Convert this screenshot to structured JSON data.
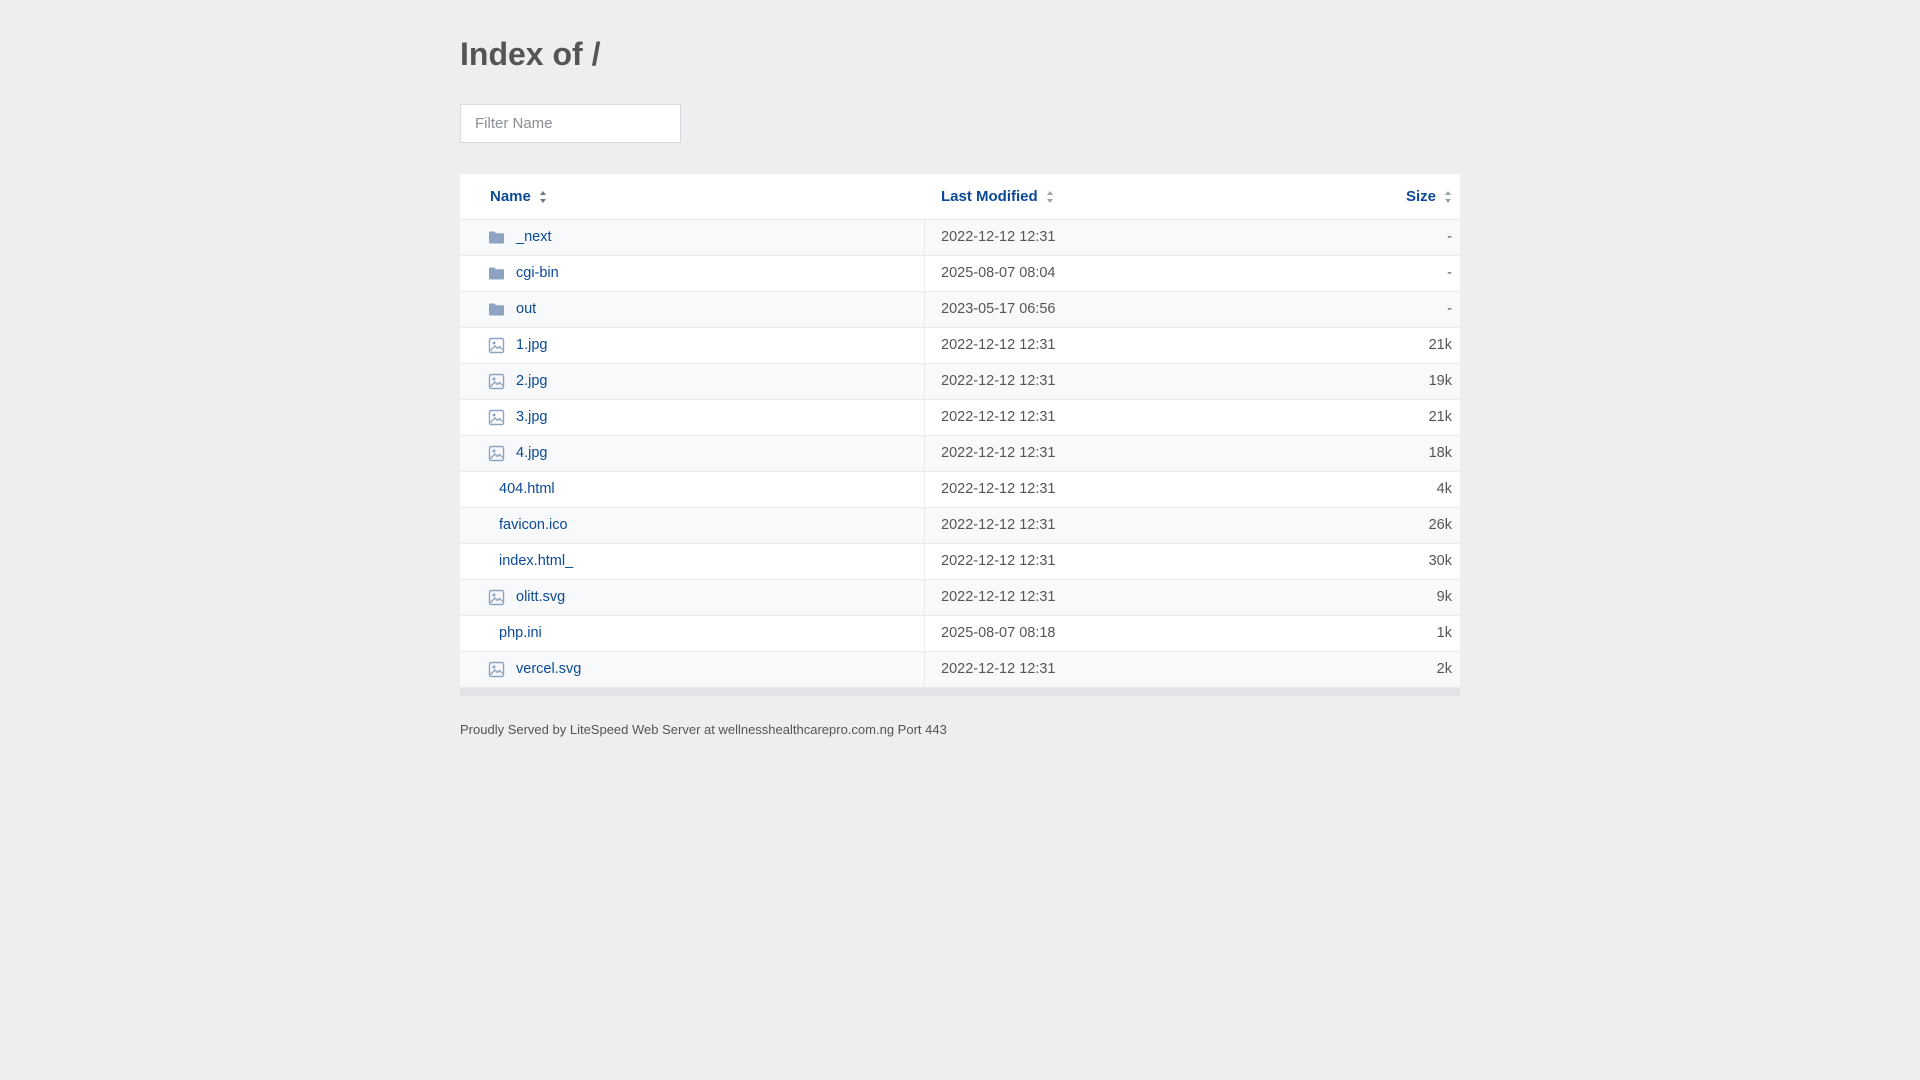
{
  "title": "Index of /",
  "filter": {
    "placeholder": "Filter Name"
  },
  "columns": {
    "name": "Name",
    "modified": "Last Modified",
    "size": "Size"
  },
  "colors": {
    "link": "#0b4a96",
    "background": "#edeef0",
    "folder_icon": "#8ea3c2"
  },
  "rows": [
    {
      "name": "_next",
      "modified": "2022-12-12 12:31",
      "size": "-",
      "icon": "folder-icon"
    },
    {
      "name": "cgi-bin",
      "modified": "2025-08-07 08:04",
      "size": "-",
      "icon": "folder-icon"
    },
    {
      "name": "out",
      "modified": "2023-05-17 06:56",
      "size": "-",
      "icon": "folder-icon"
    },
    {
      "name": "1.jpg",
      "modified": "2022-12-12 12:31",
      "size": "21k",
      "icon": "image-icon"
    },
    {
      "name": "2.jpg",
      "modified": "2022-12-12 12:31",
      "size": "19k",
      "icon": "image-icon"
    },
    {
      "name": "3.jpg",
      "modified": "2022-12-12 12:31",
      "size": "21k",
      "icon": "image-icon"
    },
    {
      "name": "4.jpg",
      "modified": "2022-12-12 12:31",
      "size": "18k",
      "icon": "image-icon"
    },
    {
      "name": "404.html",
      "modified": "2022-12-12 12:31",
      "size": "4k",
      "icon": ""
    },
    {
      "name": "favicon.ico",
      "modified": "2022-12-12 12:31",
      "size": "26k",
      "icon": ""
    },
    {
      "name": "index.html_",
      "modified": "2022-12-12 12:31",
      "size": "30k",
      "icon": ""
    },
    {
      "name": "olitt.svg",
      "modified": "2022-12-12 12:31",
      "size": "9k",
      "icon": "image-icon"
    },
    {
      "name": "php.ini",
      "modified": "2025-08-07 08:18",
      "size": "1k",
      "icon": ""
    },
    {
      "name": "vercel.svg",
      "modified": "2022-12-12 12:31",
      "size": "2k",
      "icon": "image-icon"
    }
  ],
  "footer": "Proudly Served by LiteSpeed Web Server at wellnesshealthcarepro.com.ng Port 443"
}
